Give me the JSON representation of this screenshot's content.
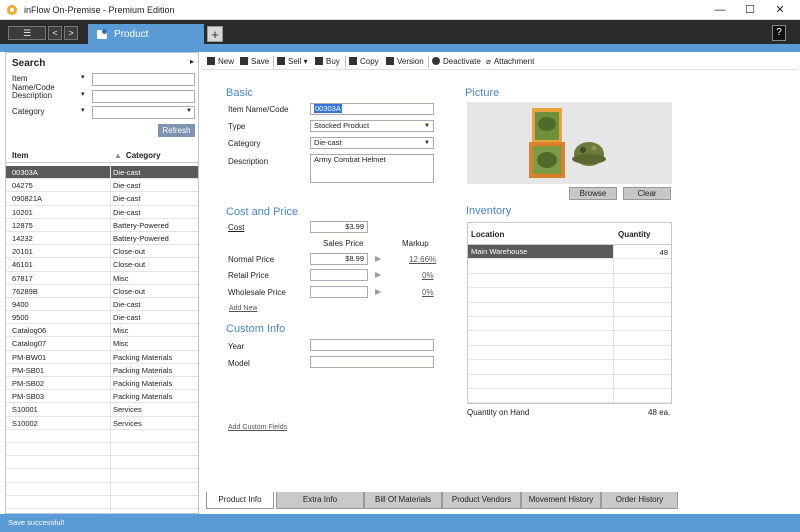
{
  "window": {
    "title": "inFlow On-Premise - Premium Edition",
    "minimize": "—",
    "maximize": "☐",
    "close": "✕"
  },
  "tabbar": {
    "menu_glyph": "☰",
    "back_glyph": "<",
    "forward_glyph": ">",
    "product_tab": "Product",
    "add_tab": "+",
    "help": "?"
  },
  "search": {
    "title": "Search",
    "collapse_glyph": "▸",
    "filters": [
      {
        "label": "Item Name/Code",
        "value": ""
      },
      {
        "label": "Description",
        "value": ""
      },
      {
        "label": "Category",
        "value": ""
      }
    ],
    "refresh": "Refresh",
    "columns": [
      "Item",
      "Category"
    ],
    "rows": [
      {
        "item": "00303A",
        "category": "Die-cast"
      },
      {
        "item": "04275",
        "category": "Die-cast"
      },
      {
        "item": "090821A",
        "category": "Die-cast"
      },
      {
        "item": "10201",
        "category": "Die-cast"
      },
      {
        "item": "12875",
        "category": "Battery-Powered"
      },
      {
        "item": "14232",
        "category": "Battery-Powered"
      },
      {
        "item": "20101",
        "category": "Close-out"
      },
      {
        "item": "46101",
        "category": "Close-out"
      },
      {
        "item": "67817",
        "category": "Misc"
      },
      {
        "item": "76289B",
        "category": "Close-out"
      },
      {
        "item": "9400",
        "category": "Die-cast"
      },
      {
        "item": "9500",
        "category": "Die-cast"
      },
      {
        "item": "Catalog06",
        "category": "Misc"
      },
      {
        "item": "Catalog07",
        "category": "Misc"
      },
      {
        "item": "PM-BW01",
        "category": "Packing Materials"
      },
      {
        "item": "PM-SB01",
        "category": "Packing Materials"
      },
      {
        "item": "PM-SB02",
        "category": "Packing Materials"
      },
      {
        "item": "PM-SB03",
        "category": "Packing Materials"
      },
      {
        "item": "S10001",
        "category": "Services"
      },
      {
        "item": "S10002",
        "category": "Services"
      },
      {
        "item": "",
        "category": ""
      },
      {
        "item": "",
        "category": ""
      },
      {
        "item": "",
        "category": ""
      },
      {
        "item": "",
        "category": ""
      },
      {
        "item": "",
        "category": ""
      },
      {
        "item": "",
        "category": ""
      },
      {
        "item": "",
        "category": ""
      }
    ]
  },
  "toolbar": {
    "new": "New",
    "save": "Save",
    "sell": "Sell",
    "buy": "Buy",
    "copy": "Copy",
    "version": "Version",
    "deactivate": "Deactivate",
    "attachment": "Attachment"
  },
  "basic": {
    "title": "Basic",
    "item_label": "Item Name/Code",
    "item_value": "00303A",
    "type_label": "Type",
    "type_value": "Stocked Product",
    "category_label": "Category",
    "category_value": "Die-cast",
    "description_label": "Description",
    "description_value": "Army Combat Helmet"
  },
  "cost": {
    "title": "Cost and Price",
    "cost_label": "Cost",
    "cost_value": "$3.99",
    "sales_price_header": "Sales Price",
    "markup_header": "Markup",
    "normal_label": "Normal Price",
    "normal_value": "$8.99",
    "normal_markup": "12.66%",
    "retail_label": "Retail Price",
    "retail_value": "",
    "retail_markup": "0%",
    "wholesale_label": "Wholesale Price",
    "wholesale_value": "",
    "wholesale_markup": "0%",
    "add_new": "Add New"
  },
  "custom": {
    "title": "Custom Info",
    "year_label": "Year",
    "year_value": "",
    "model_label": "Model",
    "model_value": "",
    "add_fields": "Add Custom Fields"
  },
  "picture": {
    "title": "Picture",
    "browse": "Browse",
    "clear": "Clear"
  },
  "inventory": {
    "title": "Inventory",
    "columns": [
      "Location",
      "Quantity"
    ],
    "rows": [
      {
        "location": "Main Warehouse",
        "quantity": "48"
      }
    ],
    "on_hand_label": "Quantity on Hand",
    "on_hand_value": "48 ea."
  },
  "bottom_tabs": [
    "Product Info",
    "Extra Info",
    "Bill Of Materials",
    "Product Vendors",
    "Movement History",
    "Order History"
  ],
  "status": "Save successful!",
  "colors": {
    "accent": "#5b9bd5",
    "section_title": "#4a86c6",
    "selection": "#5a5a5a"
  }
}
